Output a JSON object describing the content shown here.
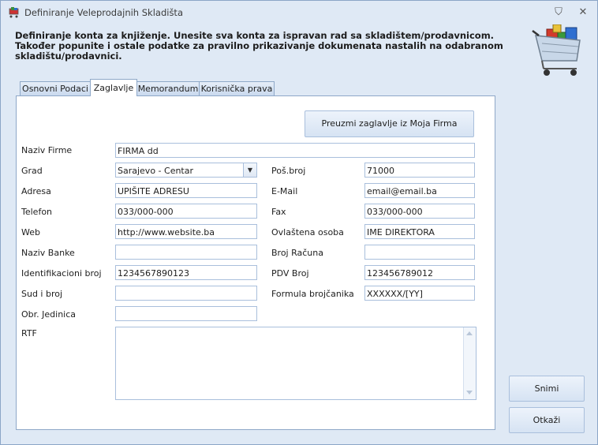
{
  "window": {
    "title": "Definiranje Veleprodajnih Skladišta",
    "pin_glyph": "⛉",
    "close_glyph": "✕"
  },
  "header": {
    "line1": "Definiranje konta za knjiženje. Unesite sva konta za ispravan rad sa skladištem/prodavnicom.",
    "line2": "Također popunite i ostale podatke za pravilno prikazivanje dokumenata nastalih na odabranom",
    "line3": "skladištu/prodavnici."
  },
  "tabs": [
    "Osnovni Podaci",
    "Zaglavlje",
    "Memorandum",
    "Korisnička prava"
  ],
  "active_tab": "Zaglavlje",
  "form": {
    "fetch_button": "Preuzmi zaglavlje iz Moja Firma",
    "naziv_firme_label": "Naziv Firme",
    "naziv_firme_value": "FIRMA dd",
    "grad_label": "Grad",
    "grad_value": "Sarajevo - Centar",
    "adresa_label": "Adresa",
    "adresa_value": "UPIŠITE ADRESU",
    "telefon_label": "Telefon",
    "telefon_value": "033/000-000",
    "web_label": "Web",
    "web_value": "http://www.website.ba",
    "naziv_banke_label": "Naziv Banke",
    "naziv_banke_value": "",
    "id_broj_label": "Identifikacioni broj",
    "id_broj_value": "1234567890123",
    "sud_label": "Sud i broj",
    "sud_value": "",
    "obr_label": "Obr. Jedinica",
    "obr_value": "",
    "rtf_label": "RTF",
    "pos_broj_label": "Poš.broj",
    "pos_broj_value": "71000",
    "email_label": "E-Mail",
    "email_value": "email@email.ba",
    "fax_label": "Fax",
    "fax_value": "033/000-000",
    "osoba_label": "Ovlaštena osoba",
    "osoba_value": "IME DIREKTORA",
    "racun_label": "Broj Računa",
    "racun_value": "",
    "pdv_label": "PDV Broj",
    "pdv_value": "123456789012",
    "formula_label": "Formula brojčanika",
    "formula_value": "XXXXXX/[YY]"
  },
  "buttons": {
    "save": "Snimi",
    "cancel": "Otkaži"
  },
  "colors": {
    "accent": "#dfe9f5",
    "border": "#8ea8c8"
  }
}
